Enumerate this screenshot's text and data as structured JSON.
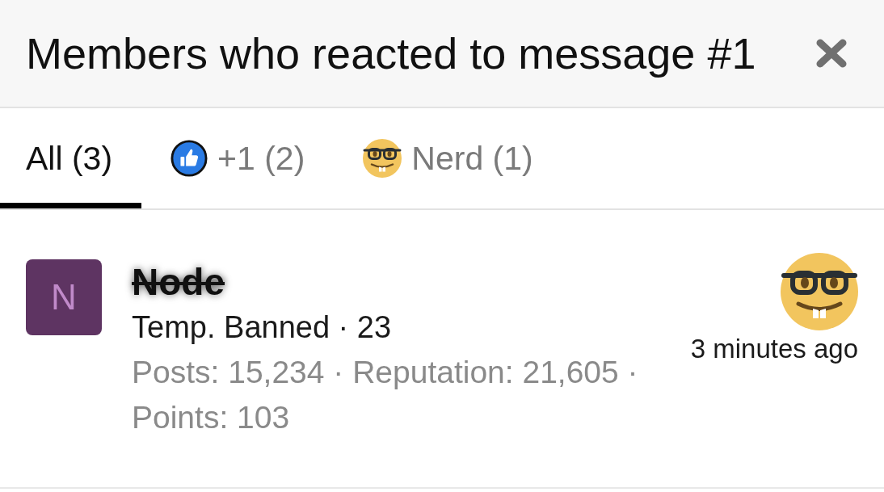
{
  "dialog": {
    "title": "Members who reacted to message #1"
  },
  "tabs": [
    {
      "label": "All (3)",
      "kind": "all",
      "selected": true
    },
    {
      "label": "+1 (2)",
      "kind": "like",
      "selected": false
    },
    {
      "label": "Nerd (1)",
      "kind": "nerd",
      "selected": false
    }
  ],
  "members": [
    {
      "avatar_letter": "N",
      "color": "#5e3462",
      "name": "Node",
      "banned": true,
      "title_line": "Temp. Banned · 23",
      "stats": "Posts: 15,234 · Reputation: 21,605 · Points: 103",
      "reaction": {
        "kind": "nerd"
      },
      "time": "3 minutes ago"
    }
  ]
}
